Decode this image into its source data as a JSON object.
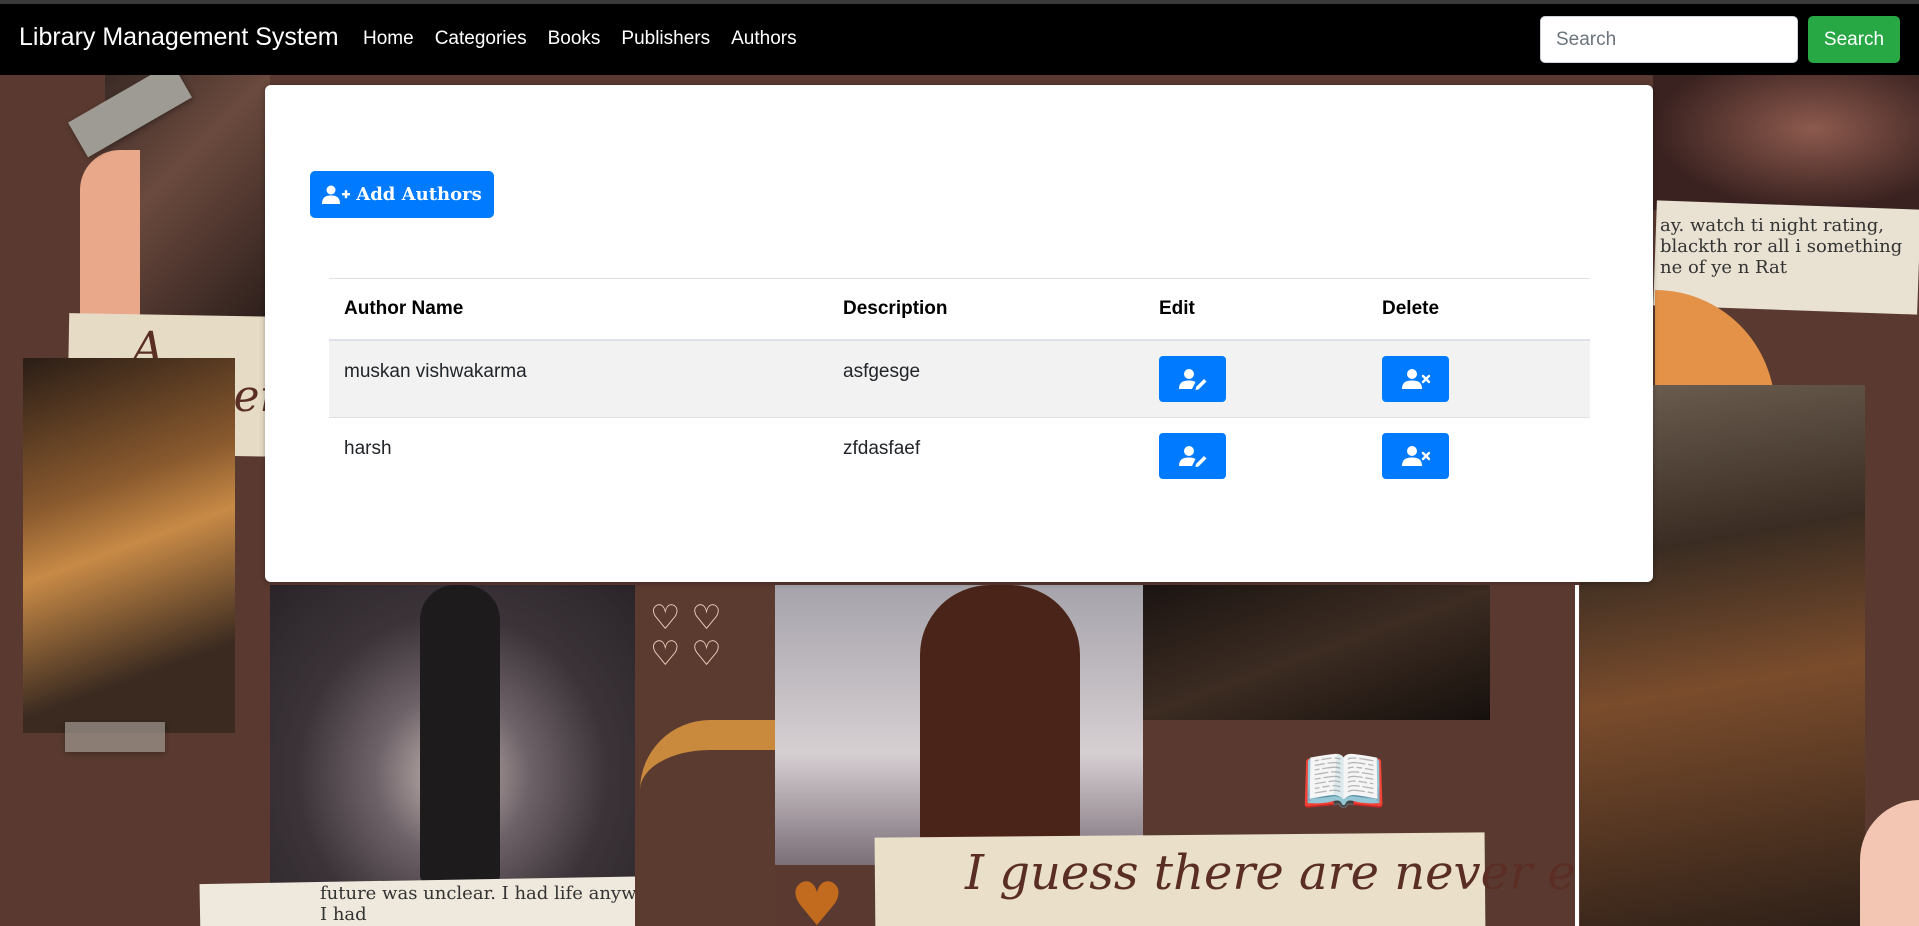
{
  "navbar": {
    "brand": "Library Management System",
    "links": [
      "Home",
      "Categories",
      "Books",
      "Publishers",
      "Authors"
    ],
    "search_placeholder": "Search",
    "search_button": "Search"
  },
  "main": {
    "add_button_label": "Add Authors",
    "table": {
      "headers": [
        "Author Name",
        "Description",
        "Edit",
        "Delete"
      ],
      "rows": [
        {
          "author_name": "muskan vishwakarma",
          "description": "asfgesge"
        },
        {
          "author_name": "harsh",
          "description": "zfdasfaef"
        }
      ]
    }
  },
  "background": {
    "quote_left": "A reader lives",
    "quote_bottom": "I guess there are never enough",
    "torn_page_words": "ay. watch ti night rating, blackth ror all i something ne of ye n Rat",
    "bottom_text": "future was unclear. I had life anyway. I had"
  },
  "colors": {
    "primary": "#007bff",
    "success": "#28a745",
    "navbar_bg": "#000000",
    "collage_brown": "#5a3a30"
  },
  "icons": {
    "add_authors": "user-plus-icon",
    "edit": "user-edit-icon",
    "delete": "user-remove-icon"
  }
}
